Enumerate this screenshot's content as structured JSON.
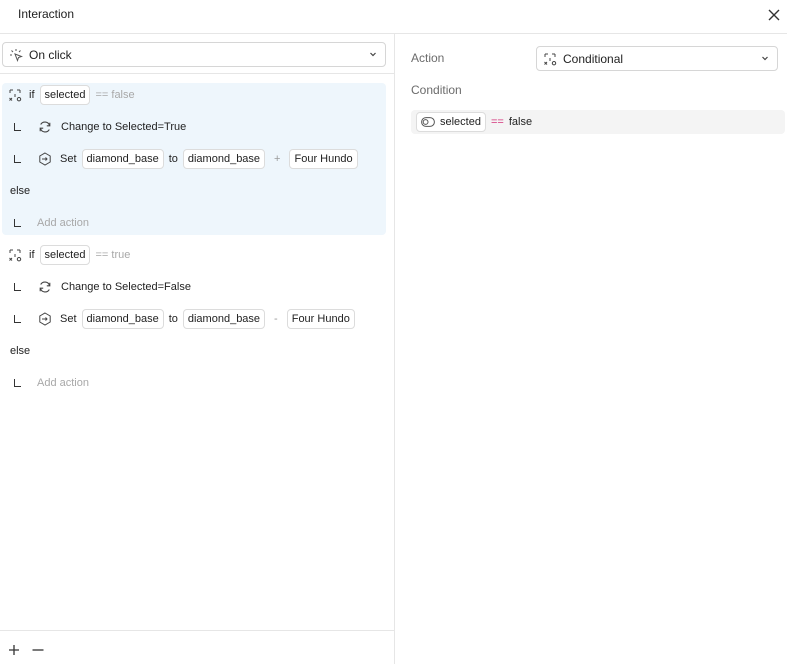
{
  "header": {
    "title": "Interaction"
  },
  "trigger": {
    "label": "On click"
  },
  "blocks": [
    {
      "if_label": "if",
      "variable": "selected",
      "operator": "== false",
      "action1": {
        "label": "Change to Selected=True"
      },
      "action2": {
        "set_label": "Set",
        "target": "diamond_base",
        "to_label": "to",
        "source": "diamond_base",
        "op": "+",
        "value": "Four Hundo"
      },
      "else_label": "else",
      "add_action": "Add action"
    },
    {
      "if_label": "if",
      "variable": "selected",
      "operator": "== true",
      "action1": {
        "label": "Change to Selected=False"
      },
      "action2": {
        "set_label": "Set",
        "target": "diamond_base",
        "to_label": "to",
        "source": "diamond_base",
        "op": "-",
        "value": "Four Hundo"
      },
      "else_label": "else",
      "add_action": "Add action"
    }
  ],
  "panel": {
    "action_label": "Action",
    "action_value": "Conditional",
    "condition_label": "Condition",
    "condition": {
      "variable": "selected",
      "operator": "==",
      "value": "false"
    }
  },
  "colors": {
    "highlight": "#eef6fc",
    "operator_pink": "#d4327a"
  }
}
